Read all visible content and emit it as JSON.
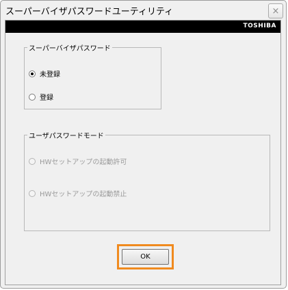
{
  "window": {
    "title": "スーパーバイザパスワードユーティリティ",
    "close_glyph": "×"
  },
  "brand": {
    "logo_text": "TOSHIBA"
  },
  "supervisor_group": {
    "legend": "スーパーバイザパスワード",
    "options": [
      {
        "label": "未登録",
        "checked": true
      },
      {
        "label": "登録",
        "checked": false
      }
    ]
  },
  "user_group": {
    "legend": "ユーザパスワードモード",
    "enabled": false,
    "options": [
      {
        "label": "HWセットアップの起動許可",
        "checked": false
      },
      {
        "label": "HWセットアップの起動禁止",
        "checked": false
      }
    ]
  },
  "ok_button": {
    "label": "OK"
  },
  "colors": {
    "highlight": "#f08a1e",
    "brand_bar": "#000000"
  }
}
